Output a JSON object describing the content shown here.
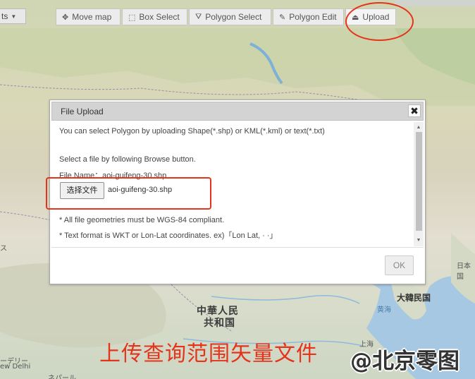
{
  "toolbar": {
    "layer_select_label": "ts",
    "buttons": [
      {
        "icon": "move-icon",
        "glyph": "✥",
        "label": "Move map"
      },
      {
        "icon": "box-select-icon",
        "glyph": "⬚",
        "label": "Box Select"
      },
      {
        "icon": "polygon-select-icon",
        "glyph": "⛛",
        "label": "Polygon Select"
      },
      {
        "icon": "polygon-edit-icon",
        "glyph": "✎",
        "label": "Polygon Edit"
      },
      {
        "icon": "upload-icon",
        "glyph": "⏏",
        "label": "Upload"
      }
    ]
  },
  "dialog": {
    "title": "File Upload",
    "close_glyph": "✖",
    "intro": "You can select Polygon by uploading Shape(*.shp) or KML(*.kml) or text(*.txt)",
    "instruction": "Select a file by following Browse button.",
    "file_name_line": "File Name：aoi-guifeng-30.shp",
    "browse_button": "选择文件",
    "selected_file": "aoi-guifeng-30.shp",
    "note1": "* All file geometries must be WGS-84 compliant.",
    "note2": "* Text format is WKT or Lon-Lat coordinates. ex)「Lon Lat, · ·」",
    "ok_button": "OK"
  },
  "map": {
    "labels": {
      "china_line1": "中華人民",
      "china_line2": "共和国",
      "korea": "大韓民国",
      "yellow_sea": "黄海",
      "shanghai": "上海",
      "japan_partial": "日本国",
      "india_partial": "ーデリー",
      "new_delhi_partial": "ew Delhi",
      "nepal_partial": "ネパール",
      "left_partial": "ス"
    }
  },
  "annotation": {
    "caption": "上传查询范围矢量文件",
    "watermark": "@北京零图"
  },
  "colors": {
    "annotation_red": "#e4341c",
    "dialog_titlebar": "#d3d3d3",
    "toolbar_button": "#ececec"
  }
}
